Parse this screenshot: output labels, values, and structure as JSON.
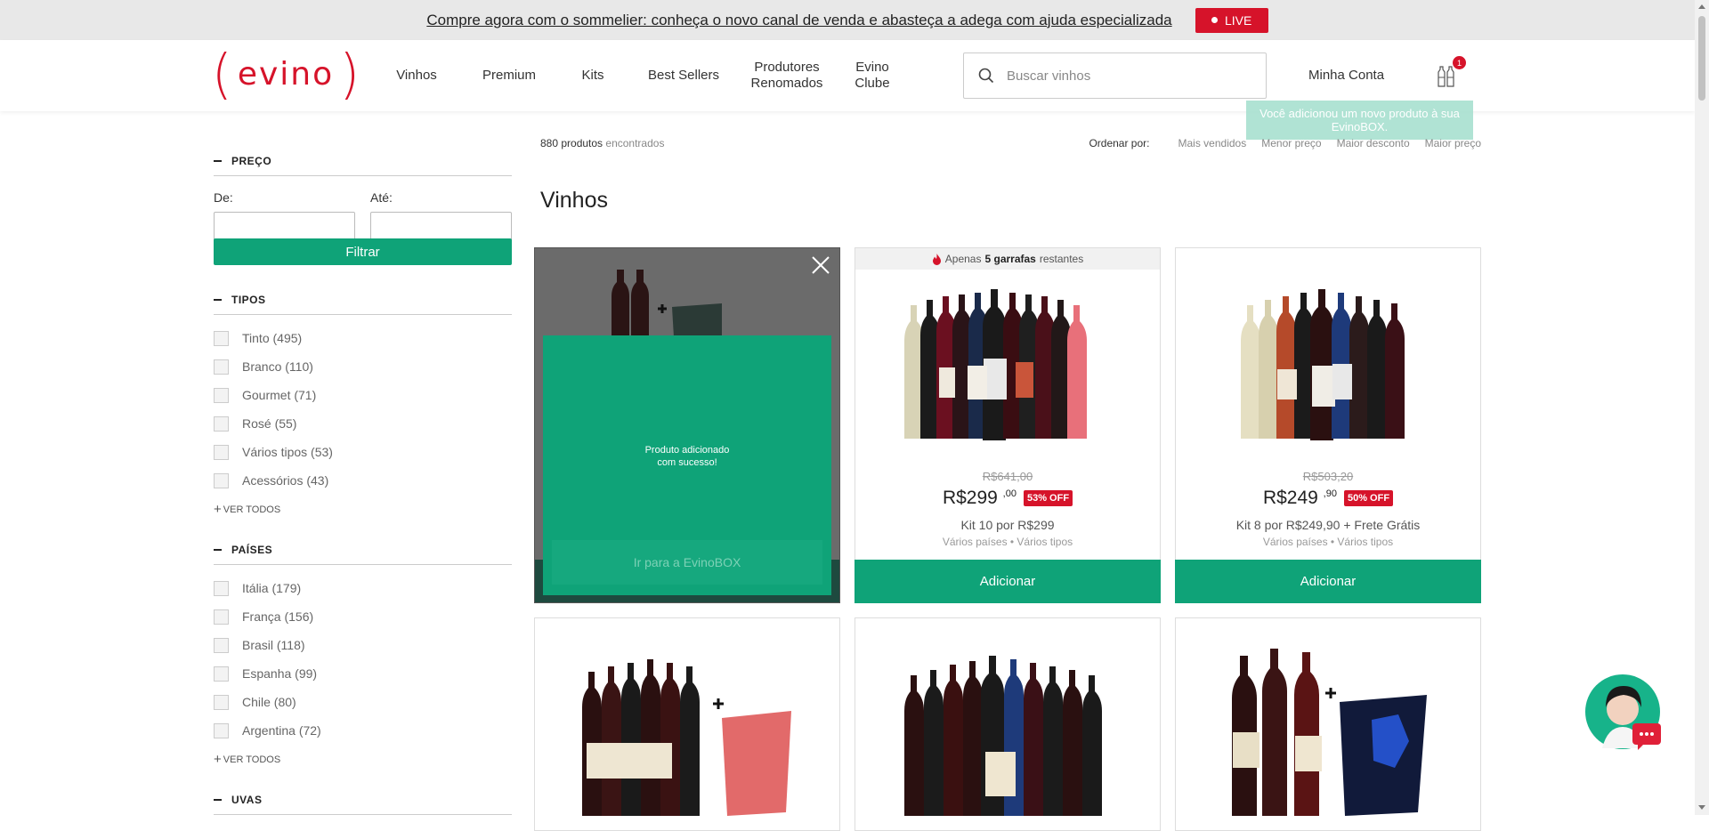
{
  "topbar": {
    "promo": "Compre agora com o sommelier: conheça o novo canal de venda e abasteça a adega com ajuda especializada",
    "live": "LIVE"
  },
  "header": {
    "logo": {
      "left": "(",
      "word": "evino",
      "right": ")"
    },
    "nav": [
      "Vinhos",
      "Premium",
      "Kits",
      "Best Sellers",
      "Produtores\nRenomados",
      "Evino\nClube"
    ],
    "search_placeholder": "Buscar vinhos",
    "account": "Minha Conta",
    "cart_count": "1",
    "toast": "Você adicionou um novo produto à sua EvinoBOX."
  },
  "filters": {
    "price": {
      "title": "PREÇO",
      "from": "De:",
      "to": "Até:",
      "button": "Filtrar"
    },
    "types": {
      "title": "TIPOS",
      "items": [
        "Tinto (495)",
        "Branco (110)",
        "Gourmet (71)",
        "Rosé (55)",
        "Vários tipos (53)",
        "Acessórios (43)"
      ],
      "more": "VER TODOS"
    },
    "countries": {
      "title": "PAÍSES",
      "items": [
        "Itália (179)",
        "França (156)",
        "Brasil (118)",
        "Espanha (99)",
        "Chile (80)",
        "Argentina (72)"
      ],
      "more": "VER TODOS"
    },
    "grapes": {
      "title": "UVAS"
    }
  },
  "results": {
    "count": "880 produtos",
    "count_suffix": " encontrados",
    "sort_label": "Ordenar por:",
    "sort_options": [
      "Mais vendidos",
      "Menor preço",
      "Maior desconto",
      "Maior preço"
    ]
  },
  "page_title": "Vinhos",
  "modal": {
    "message_line1": "Produto adicionado",
    "message_line2": "com sucesso!",
    "button": "Ir para a EvinoBOX"
  },
  "products": [
    {
      "stock_prefix": "Apenas",
      "stock_bold": "5 garrafas",
      "stock_suffix": "restantes",
      "old_price": "R$641,00",
      "price": "R$299",
      "cents": ",00",
      "off": "53% OFF",
      "kit": "Kit 10 por R$299",
      "meta": "Vários países • Vários tipos",
      "button": "Adicionar"
    },
    {
      "old_price": "R$503,20",
      "price": "R$249",
      "cents": ",90",
      "off": "50% OFF",
      "kit": "Kit 8 por R$249,90 + Frete Grátis",
      "meta": "Vários países • Vários tipos",
      "button": "Adicionar"
    }
  ],
  "colors": {
    "brand_red": "#d6132a",
    "brand_green": "#0fa378"
  }
}
